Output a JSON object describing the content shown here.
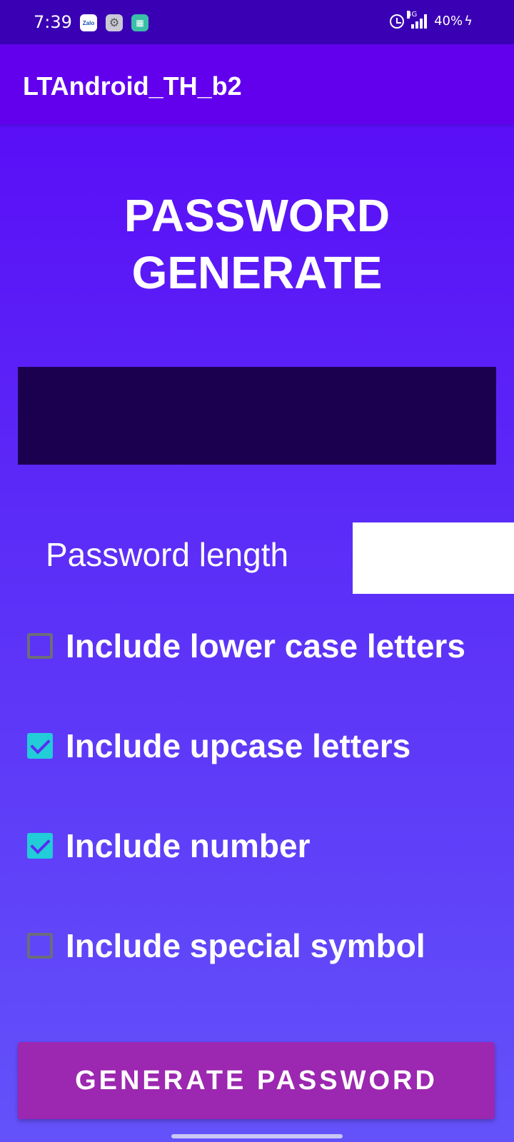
{
  "status_bar": {
    "time": "7:39",
    "notifications": [
      {
        "icon": "zalo-icon",
        "text": "Zalo"
      },
      {
        "icon": "settings-icon",
        "text": "⚙"
      },
      {
        "icon": "store-icon",
        "text": "▦"
      }
    ],
    "network": "4G",
    "battery": "40%"
  },
  "app_bar": {
    "title": "LTAndroid_TH_b2"
  },
  "main": {
    "title_line1": "PASSWORD",
    "title_line2": "GENERATE",
    "password_output": "",
    "length_label": "Password length",
    "length_value": "",
    "options": [
      {
        "label": "Include lower case letters",
        "checked": false
      },
      {
        "label": "Include upcase letters",
        "checked": true
      },
      {
        "label": "Include number",
        "checked": true
      },
      {
        "label": "Include special symbol",
        "checked": false
      }
    ],
    "generate_button": "GENERATE PASSWORD"
  },
  "colors": {
    "app_bar": "#6200ee",
    "status_bar": "#3a00b4",
    "checkbox_checked": "#22ccd8",
    "button": "#9c27b0",
    "output_box": "#1c0050"
  }
}
